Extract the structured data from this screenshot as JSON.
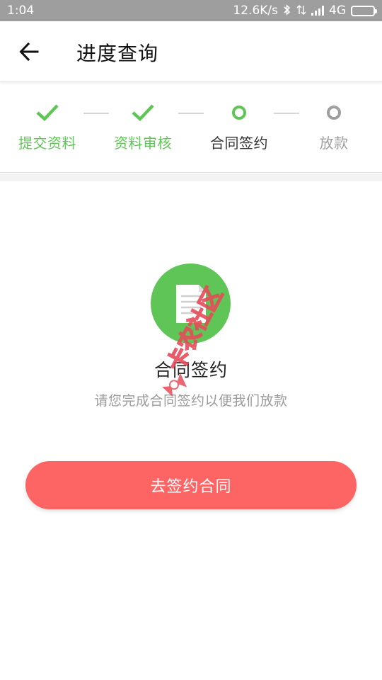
{
  "status_bar": {
    "time": "1:04",
    "network_speed": "12.6K/s",
    "network_type": "4G",
    "icons": [
      "bluetooth-icon",
      "sync-icon",
      "signal-icon",
      "battery-icon"
    ]
  },
  "header": {
    "back_icon": "arrow-left-icon",
    "title": "进度查询"
  },
  "steps": [
    {
      "label": "提交资料",
      "state": "done",
      "icon": "check-icon"
    },
    {
      "label": "资料审核",
      "state": "done",
      "icon": "check-icon"
    },
    {
      "label": "合同签约",
      "state": "current",
      "icon": "ring-icon"
    },
    {
      "label": "放款",
      "state": "pending",
      "icon": "ring-icon"
    }
  ],
  "content": {
    "icon": "document-icon",
    "title": "合同签约",
    "description": "请您完成合同签约以便我们放款"
  },
  "watermark": {
    "text": "卡农社区"
  },
  "action": {
    "label": "去签约合同"
  },
  "colors": {
    "status_bar": "#9e9e9e",
    "done_green": "#5fc556",
    "current_ring": "#5fc556",
    "pending_gray": "#9e9e9e",
    "current_text": "#333333",
    "button_red": "#fd6464",
    "description_gray": "#9a9a9a",
    "watermark_red": "#e74c5a"
  }
}
